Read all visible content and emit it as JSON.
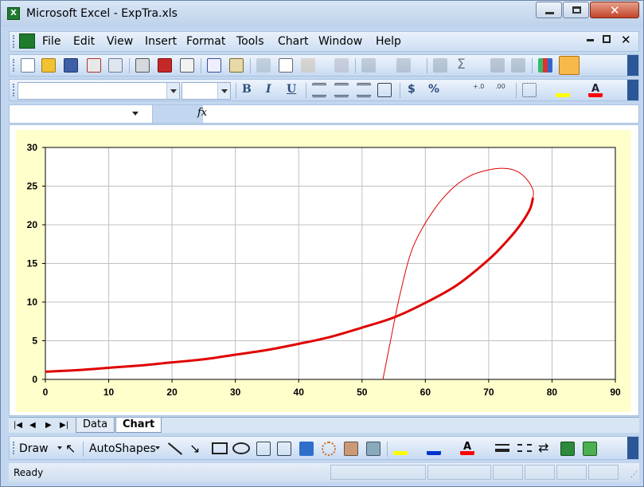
{
  "window": {
    "title": "Microsoft Excel - ExpTra.xls",
    "app_icon_letter": "X"
  },
  "menu": {
    "items": [
      "File",
      "Edit",
      "View",
      "Insert",
      "Format",
      "Tools",
      "Chart",
      "Window",
      "Help"
    ]
  },
  "formula_bar": {
    "name_box": "",
    "fx_label": "fx",
    "value": ""
  },
  "formatting": {
    "font_name": "",
    "font_size": "",
    "bold": "B",
    "italic": "I",
    "underline": "U",
    "currency": "$",
    "percent": "%"
  },
  "sheet_tabs": {
    "tabs": [
      "Data",
      "Chart"
    ],
    "active": "Chart"
  },
  "drawing_toolbar": {
    "draw_label": "Draw",
    "autoshapes_label": "AutoShapes"
  },
  "status": {
    "text": "Ready"
  },
  "chart_data": {
    "type": "scatter",
    "title": "",
    "xlabel": "",
    "ylabel": "",
    "xlim": [
      0,
      90
    ],
    "ylim": [
      0,
      30
    ],
    "xticks": [
      0,
      10,
      20,
      30,
      40,
      50,
      60,
      70,
      80,
      90
    ],
    "yticks": [
      0,
      5,
      10,
      15,
      20,
      25,
      30
    ],
    "grid": true,
    "background": "#ffffcc",
    "series": [
      {
        "style": "thick",
        "color": "#e00000",
        "x": [
          0,
          5,
          10,
          15,
          20,
          25,
          30,
          35,
          40,
          45,
          50,
          55,
          60,
          65,
          70,
          73,
          75,
          76.5,
          77
        ],
        "y": [
          1.0,
          1.2,
          1.5,
          1.8,
          2.2,
          2.6,
          3.2,
          3.8,
          4.6,
          5.5,
          6.7,
          8.0,
          9.9,
          12.2,
          15.5,
          18.0,
          20.0,
          22.0,
          23.5
        ]
      },
      {
        "style": "thin",
        "color": "#e00000",
        "x": [
          53.3,
          54.5,
          56,
          58,
          61,
          64,
          67,
          70,
          72.5,
          74.5,
          76,
          77,
          77
        ],
        "y": [
          0,
          5,
          11,
          17,
          21.5,
          24.5,
          26.3,
          27.1,
          27.3,
          26.9,
          25.9,
          24.5,
          23.5
        ]
      }
    ]
  }
}
